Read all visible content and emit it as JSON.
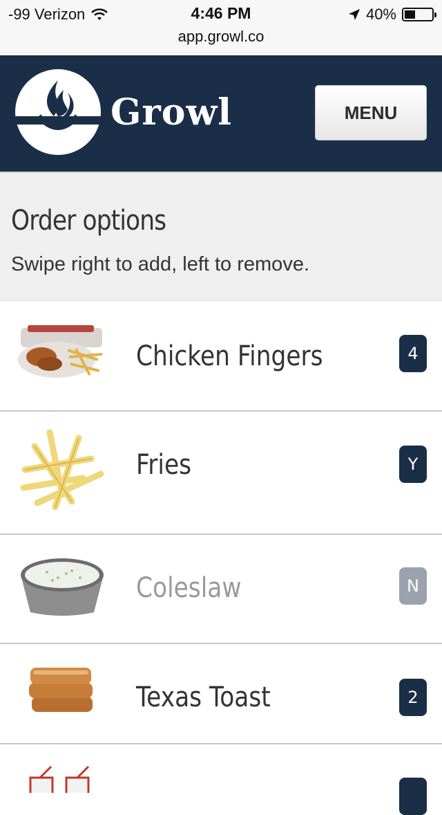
{
  "status_bar": {
    "carrier": "-99 Verizon",
    "time": "4:46 PM",
    "battery": "40%",
    "battery_level": 0.4,
    "url": "app.growl.co"
  },
  "header": {
    "brand": "Growl",
    "menu_label": "MENU",
    "color": "#1b2e48"
  },
  "intro": {
    "title": "Order options",
    "subtitle": "Swipe right to add, left to remove."
  },
  "items": [
    {
      "label": "Chicken Fingers",
      "badge": "4",
      "active": true
    },
    {
      "label": "Fries",
      "badge": "Y",
      "active": true
    },
    {
      "label": "Coleslaw",
      "badge": "N",
      "active": false
    },
    {
      "label": "Texas Toast",
      "badge": "2",
      "active": true
    }
  ]
}
